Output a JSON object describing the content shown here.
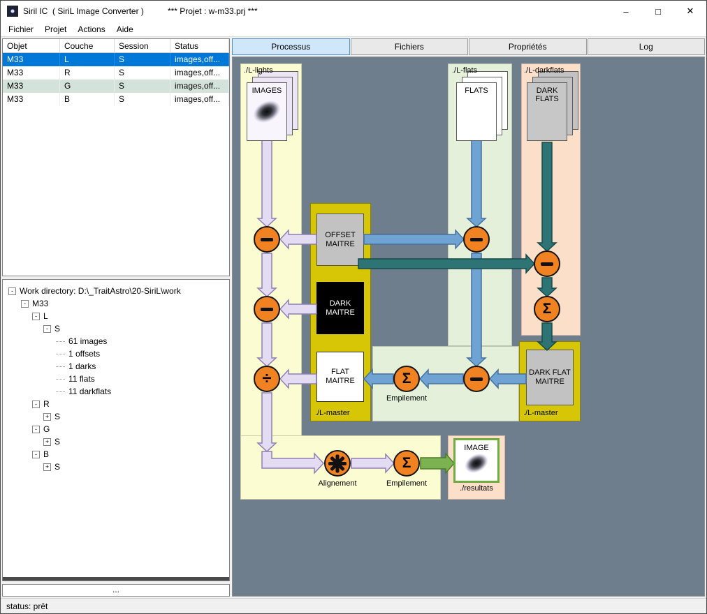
{
  "window": {
    "title": "Siril IC  ( SiriL Image Converter )",
    "project": "*** Projet : w-m33.prj ***"
  },
  "icons": {
    "minimize": "–",
    "maximize": "□",
    "close": "✕"
  },
  "menu": {
    "items": [
      {
        "label": "Fichier"
      },
      {
        "label": "Projet"
      },
      {
        "label": "Actions"
      },
      {
        "label": "Aide"
      }
    ]
  },
  "table": {
    "headers": [
      "Objet",
      "Couche",
      "Session",
      "Status"
    ],
    "rows": [
      {
        "objet": "M33",
        "couche": "L",
        "session": "S",
        "status": "images,off...",
        "state": "selected"
      },
      {
        "objet": "M33",
        "couche": "R",
        "session": "S",
        "status": "images,off...",
        "state": "normal"
      },
      {
        "objet": "M33",
        "couche": "G",
        "session": "S",
        "status": "images,off...",
        "state": "highlight"
      },
      {
        "objet": "M33",
        "couche": "B",
        "session": "S",
        "status": "images,off...",
        "state": "normal"
      }
    ]
  },
  "tree": {
    "glyphs": {
      "minus": "-",
      "plus": "+"
    },
    "more_label": "...",
    "items": [
      {
        "label": "Work directory: D:\\_TraitAstro\\20-SiriL\\work",
        "depth": 0,
        "kind": "expanded"
      },
      {
        "label": "M33",
        "depth": 1,
        "kind": "expanded"
      },
      {
        "label": "L",
        "depth": 2,
        "kind": "expanded"
      },
      {
        "label": "S",
        "depth": 3,
        "kind": "expanded"
      },
      {
        "label": "61 images",
        "depth": 4,
        "kind": "leaf"
      },
      {
        "label": "1 offsets",
        "depth": 4,
        "kind": "leaf"
      },
      {
        "label": "1 darks",
        "depth": 4,
        "kind": "leaf"
      },
      {
        "label": "11 flats",
        "depth": 4,
        "kind": "leaf"
      },
      {
        "label": "11 darkflats",
        "depth": 4,
        "kind": "leaf"
      },
      {
        "label": "R",
        "depth": 2,
        "kind": "expanded"
      },
      {
        "label": "S",
        "depth": 3,
        "kind": "collapsed"
      },
      {
        "label": "G",
        "depth": 2,
        "kind": "expanded"
      },
      {
        "label": "S",
        "depth": 3,
        "kind": "collapsed"
      },
      {
        "label": "B",
        "depth": 2,
        "kind": "expanded"
      },
      {
        "label": "S",
        "depth": 3,
        "kind": "collapsed"
      }
    ]
  },
  "tabs": {
    "items": [
      {
        "label": "Processus",
        "active": true
      },
      {
        "label": "Fichiers"
      },
      {
        "label": "Propriétés"
      },
      {
        "label": "Log"
      }
    ]
  },
  "diagram": {
    "panels": {
      "lights_label": "./L-lights",
      "flats_label": "./L-flats",
      "darkflats_label": "./L-darkflats",
      "master_left_label": "./L-master",
      "master_right_label": "./L-master",
      "resultats_label": "./resultats"
    },
    "boxes": {
      "images": "IMAGES",
      "flats": "FLATS",
      "darkflats": "DARK FLATS",
      "offset_master": "OFFSET MAITRE",
      "dark_master": "DARK MAITRE",
      "flat_master": "FLAT MAITRE",
      "darkflat_master": "DARK FLAT MAITRE",
      "result_image": "IMAGE"
    },
    "ops": {
      "minus": "−",
      "divide": "÷",
      "sigma": "Σ",
      "gear": "gear"
    },
    "labels": {
      "empilement1": "Empilement",
      "empilement2": "Empilement",
      "alignement": "Alignement"
    },
    "colors": {
      "bg": "#6e7e8c",
      "lights": "#fcfcd2",
      "flats": "#e4f0da",
      "darkflats": "#fbdfc9",
      "master": "#d6c606",
      "node": "#f08222"
    }
  },
  "statusbar": {
    "text": "status: prêt"
  }
}
